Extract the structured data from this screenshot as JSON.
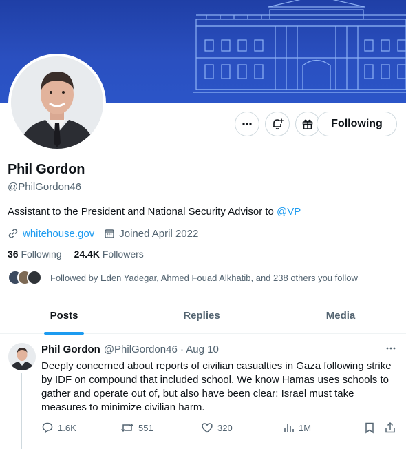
{
  "colors": {
    "accent": "#1d9bf0",
    "banner": "#2a4fbf",
    "text": "#0f1419",
    "muted": "#536471"
  },
  "profile": {
    "name": "Phil Gordon",
    "handle": "@PhilGordon46",
    "bio_text": "Assistant to the President and National Security Advisor to ",
    "bio_mention": "@VP",
    "website": "whitehouse.gov",
    "joined": "Joined April 2022",
    "following_count": "36",
    "following_label": "Following",
    "followers_count": "24.4K",
    "followers_label": "Followers",
    "followed_by": "Followed by Eden Yadegar, Ahmed Fouad Alkhatib, and 238 others you follow"
  },
  "actions": {
    "more_icon": "more-icon",
    "notify_icon": "bell-plus-icon",
    "subscribe_icon": "gift-icon",
    "follow_label": "Following"
  },
  "tabs": [
    {
      "label": "Posts",
      "active": true
    },
    {
      "label": "Replies",
      "active": false
    },
    {
      "label": "Media",
      "active": false
    }
  ],
  "tweet": {
    "name": "Phil Gordon",
    "meta": "@PhilGordon46 · Aug 10",
    "text": "Deeply concerned about reports of civilian casualties in Gaza following strike by IDF on compound that included school. We know Hamas uses schools to gather and operate out of, but also have been clear: Israel must take measures to minimize civilian harm.",
    "replies": "1.6K",
    "reposts": "551",
    "likes": "320",
    "views": "1M"
  }
}
